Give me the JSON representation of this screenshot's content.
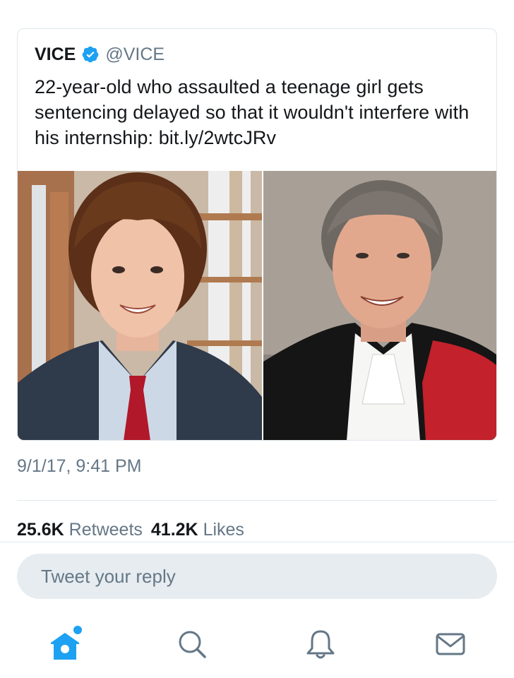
{
  "tweet": {
    "author_name": "VICE",
    "author_handle": "@VICE",
    "text": "22-year-old who assaulted a teenage girl gets sentencing delayed so that it wouldn't interfere with his internship: bit.ly/2wtcJRv",
    "timestamp": "9/1/17, 9:41 PM",
    "retweets_count": "25.6K",
    "retweets_label": "Retweets",
    "likes_count": "41.2K",
    "likes_label": "Likes",
    "verified_icon": "verified-badge-icon"
  },
  "reply": {
    "placeholder": "Tweet your reply"
  },
  "tabbar": {
    "items": [
      "home-icon",
      "search-icon",
      "notifications-icon",
      "messages-icon"
    ],
    "has_new_home": true
  },
  "colors": {
    "accent": "#1da1f2",
    "secondary_text": "#657786",
    "primary_text": "#14171a",
    "divider": "#e1e8ed",
    "reply_bg": "#e6ecf0"
  }
}
